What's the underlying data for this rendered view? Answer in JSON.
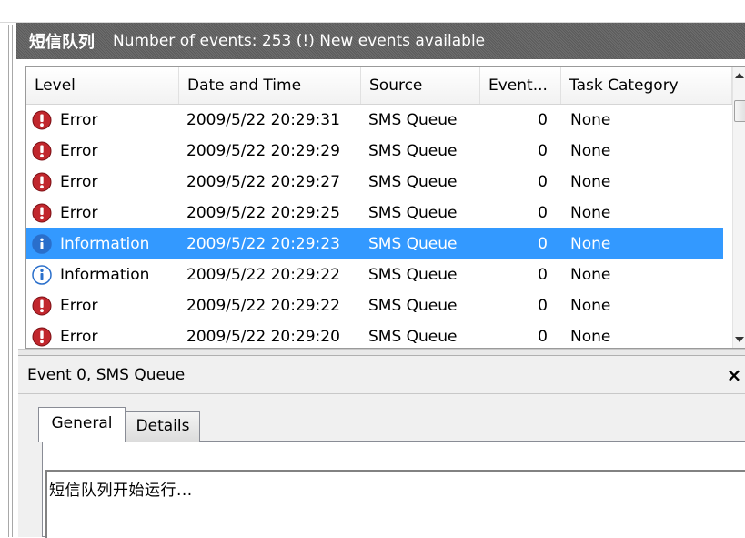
{
  "window": {
    "title": "短信队列",
    "event_count_text": "Number of events: 253 (!) New events available"
  },
  "columns": [
    "Level",
    "Date and Time",
    "Source",
    "Event...",
    "Task Category"
  ],
  "events": [
    {
      "level": "Error",
      "icon": "error-icon",
      "datetime": "2009/5/22 20:29:31",
      "source": "SMS Queue",
      "event_id": "0",
      "task_category": "None",
      "selected": false
    },
    {
      "level": "Error",
      "icon": "error-icon",
      "datetime": "2009/5/22 20:29:29",
      "source": "SMS Queue",
      "event_id": "0",
      "task_category": "None",
      "selected": false
    },
    {
      "level": "Error",
      "icon": "error-icon",
      "datetime": "2009/5/22 20:29:27",
      "source": "SMS Queue",
      "event_id": "0",
      "task_category": "None",
      "selected": false
    },
    {
      "level": "Error",
      "icon": "error-icon",
      "datetime": "2009/5/22 20:29:25",
      "source": "SMS Queue",
      "event_id": "0",
      "task_category": "None",
      "selected": false
    },
    {
      "level": "Information",
      "icon": "information-icon",
      "datetime": "2009/5/22 20:29:23",
      "source": "SMS Queue",
      "event_id": "0",
      "task_category": "None",
      "selected": true
    },
    {
      "level": "Information",
      "icon": "information-icon",
      "datetime": "2009/5/22 20:29:22",
      "source": "SMS Queue",
      "event_id": "0",
      "task_category": "None",
      "selected": false
    },
    {
      "level": "Error",
      "icon": "error-icon",
      "datetime": "2009/5/22 20:29:22",
      "source": "SMS Queue",
      "event_id": "0",
      "task_category": "None",
      "selected": false
    },
    {
      "level": "Error",
      "icon": "error-icon",
      "datetime": "2009/5/22 20:29:20",
      "source": "SMS Queue",
      "event_id": "0",
      "task_category": "None",
      "selected": false
    }
  ],
  "details": {
    "header": "Event 0, SMS Queue",
    "close_label": "×",
    "tabs": [
      {
        "label": "General",
        "active": true
      },
      {
        "label": "Details",
        "active": false
      }
    ],
    "description": "短信队列开始运行..."
  },
  "colors": {
    "selection": "#3399ff",
    "error_icon": "#c1272d",
    "info_icon": "#2a6fcb"
  }
}
